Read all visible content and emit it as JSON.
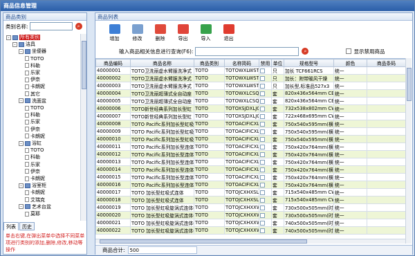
{
  "window": {
    "title": "商品信息管理"
  },
  "left_panel": {
    "title": "商品类别",
    "search_label": "类别名称:",
    "search_value": "",
    "tree": [
      {
        "label": "所有类别",
        "level": 0,
        "expander": "-",
        "type": "folder",
        "selected": true
      },
      {
        "label": "洁具",
        "level": 1,
        "expander": "-",
        "type": "folder"
      },
      {
        "label": "坐便器",
        "level": 2,
        "expander": "-",
        "type": "folder"
      },
      {
        "label": "TOTO",
        "level": 3,
        "type": "leaf"
      },
      {
        "label": "科勒",
        "level": 3,
        "type": "leaf"
      },
      {
        "label": "乐家",
        "level": 3,
        "type": "leaf"
      },
      {
        "label": "伊奈",
        "level": 3,
        "type": "leaf"
      },
      {
        "label": "卡朗妮",
        "level": 3,
        "type": "leaf"
      },
      {
        "label": "其它",
        "level": 3,
        "type": "leaf"
      },
      {
        "label": "洗面盆",
        "level": 2,
        "expander": "-",
        "type": "folder"
      },
      {
        "label": "TOTO",
        "level": 3,
        "type": "leaf"
      },
      {
        "label": "科勒",
        "level": 3,
        "type": "leaf"
      },
      {
        "label": "乐家",
        "level": 3,
        "type": "leaf"
      },
      {
        "label": "伊奈",
        "level": 3,
        "type": "leaf"
      },
      {
        "label": "卡朗妮",
        "level": 3,
        "type": "leaf"
      },
      {
        "label": "浴缸",
        "level": 2,
        "expander": "-",
        "type": "folder"
      },
      {
        "label": "TOTO",
        "level": 3,
        "type": "leaf"
      },
      {
        "label": "科勒",
        "level": 3,
        "type": "leaf"
      },
      {
        "label": "乐家",
        "level": 3,
        "type": "leaf"
      },
      {
        "label": "伊奈",
        "level": 3,
        "type": "leaf"
      },
      {
        "label": "卡朗妮",
        "level": 3,
        "type": "leaf"
      },
      {
        "label": "浴室柜",
        "level": 2,
        "expander": "-",
        "type": "folder"
      },
      {
        "label": "卡朗妮",
        "level": 3,
        "type": "leaf"
      },
      {
        "label": "艾瑞克",
        "level": 3,
        "type": "leaf"
      },
      {
        "label": "艺术台盆",
        "level": 2,
        "expander": "-",
        "type": "folder"
      },
      {
        "label": "莫耶",
        "level": 3,
        "type": "leaf"
      }
    ],
    "tabs": [
      "列表",
      "历史"
    ],
    "hint": "单击右键,在弹出菜单中选择不同菜单项进行类别的添加,删除,修改,移动等操作"
  },
  "right_panel": {
    "title": "商品列表",
    "toolbar": [
      {
        "label": "增加",
        "icon": "add-icon",
        "color": "#3d7fd6"
      },
      {
        "label": "修改",
        "icon": "edit-icon",
        "color": "#7aa0cf"
      },
      {
        "label": "删除",
        "icon": "delete-icon",
        "color": "#e04a3a"
      },
      {
        "label": "导出",
        "icon": "export-icon",
        "color": "#e0453a"
      },
      {
        "label": "导入",
        "icon": "import-icon",
        "color": "#37a24b"
      },
      {
        "label": "退出",
        "icon": "exit-icon",
        "color": "#e03c2f"
      }
    ],
    "query_label": "输入商品相关信息进行查询(F6):",
    "query_value": "",
    "show_disabled_label": "显示禁用商品",
    "columns": [
      "商品编码",
      "商品名称",
      "商品类别",
      "名称简码",
      "禁用",
      "单位",
      "规格型号",
      "颜色",
      "商品条码"
    ],
    "rows": [
      [
        "40000001",
        "TOTO卫洗丽虚水臂服洗净式",
        "TOTO",
        "TOTOWXLWSTB",
        "",
        "只",
        "加长 TCF661RCS",
        "统一",
        ""
      ],
      [
        "40000002",
        "TOTO卫洗丽虚水臂服洗净式",
        "TOTO",
        "TOTOWXLWSTB",
        "",
        "只",
        "加长：附带暖风干燥",
        "统一",
        ""
      ],
      [
        "40000003",
        "TOTO卫洗丽虚水臂服洗净式",
        "TOTO",
        "TOTOWXLWSTB",
        "",
        "只",
        "加长型,标准品527x3",
        "统一",
        ""
      ],
      [
        "40000004",
        "TOTO卫洗丽超薄式全自动座",
        "TOTO",
        "TOTOWXLCSQZ",
        "",
        "套",
        "820x436x564mm CES",
        "统一",
        ""
      ],
      [
        "40000005",
        "TOTO卫洗丽超薄式全自动座",
        "TOTO",
        "TOTOWXLCSQZ",
        "",
        "套",
        "820x436x564mm CES",
        "统一",
        ""
      ],
      [
        "40000006",
        "TOTO新世经典系列加长型虹",
        "TOTO",
        "TOTOXSJDXLJC",
        "",
        "套",
        "732x538x802mm CW7",
        "统一",
        ""
      ],
      [
        "40000007",
        "TOTO新世经典系列加长型虹",
        "TOTO",
        "TOTOXSJDXLJC",
        "",
        "套",
        "722x468x695mm CW7",
        "统一",
        ""
      ],
      [
        "40000008",
        "TOTO Pacific系列加长型虹吸",
        "TOTO",
        "TOTOACIFICXL",
        "",
        "套",
        "750x540x595mm(横冲",
        "统一",
        ""
      ],
      [
        "40000009",
        "TOTO Pacific系列加长型虹吸",
        "TOTO",
        "TOTOACIFICXL",
        "",
        "套",
        "750x540x595mm(横冲",
        "统一",
        ""
      ],
      [
        "40000010",
        "TOTO Pacific系列加长型虹吸",
        "TOTO",
        "TOTOACIFICXL",
        "",
        "套",
        "750x540x595mm(横冲",
        "统一",
        ""
      ],
      [
        "40000011",
        "TOTO Pacific系列加长型连体",
        "TOTO",
        "TOTOACIFICXL",
        "",
        "套",
        "750x420x764mm(横冲",
        "统一",
        ""
      ],
      [
        "40000012",
        "TOTO Pacific系列加长型连体",
        "TOTO",
        "TOTOACIFICXL",
        "",
        "套",
        "750x420x764mm(横冲",
        "统一",
        ""
      ],
      [
        "40000013",
        "TOTO Pacific系列加长型连体",
        "TOTO",
        "TOTOACIFICXL",
        "",
        "套",
        "750x420x764mm(横冲",
        "统一",
        ""
      ],
      [
        "40000014",
        "TOTO Pacific系列加长型连体",
        "TOTO",
        "TOTOACIFICXL",
        "",
        "套",
        "750x420x764mm(横冲",
        "统一",
        ""
      ],
      [
        "40000015",
        "TOTO Pacific系列加长型连体",
        "TOTO",
        "TOTOACIFICXL",
        "",
        "套",
        "750x420x764mm(横冲",
        "统一",
        ""
      ],
      [
        "40000016",
        "TOTO Pacific系列加长型连体",
        "TOTO",
        "TOTOACIFICXL",
        "",
        "套",
        "750x420x764mm(横冲",
        "统一",
        ""
      ],
      [
        "40000017",
        "TOTO 加长型虹吸式连体",
        "TOTO",
        "TOTOJCXHXSL",
        "",
        "套",
        "715x540x485mm CW7",
        "统一",
        ""
      ],
      [
        "40000018",
        "TOTO 加长型虹吸式连体",
        "TOTO",
        "TOTOJCXHXSL",
        "",
        "套",
        "715x540x485mm CW7",
        "统一",
        ""
      ],
      [
        "40000019",
        "TOTO 加长型虹吸旋涡式连体(",
        "TOTO",
        "TOTOJCXHXXW",
        "",
        "套",
        "730x500x505mm(时尚",
        "统一",
        ""
      ],
      [
        "40000020",
        "TOTO 加长型虹吸旋涡式连体(",
        "TOTO",
        "TOTOJCXHXXW",
        "",
        "套",
        "730x500x505mm(时尚",
        "统一",
        ""
      ],
      [
        "40000021",
        "TOTO 加长型虹吸旋涡式连体(",
        "TOTO",
        "TOTOJCXHXXW",
        "",
        "套",
        "740x500x505mm(时尚",
        "统一",
        ""
      ],
      [
        "40000022",
        "TOTO 加长型虹吸旋涡式连体(",
        "TOTO",
        "TOTOJCXHXXW",
        "",
        "套",
        "740x500x505mm(时尚",
        "统一",
        ""
      ]
    ],
    "footer_label": "商品合计:",
    "footer_value": "500"
  }
}
